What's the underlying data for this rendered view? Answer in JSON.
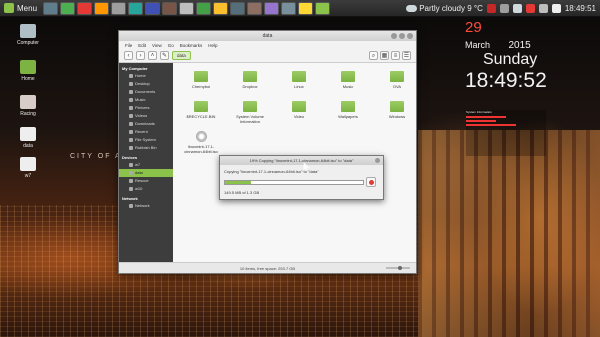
{
  "panel": {
    "menu_label": "Menu",
    "launcher_colors": [
      "#607d8b",
      "#4caf50",
      "#e53935",
      "#ff9800",
      "#9e9e9e",
      "#26a69a",
      "#3f51b5",
      "#795548",
      "#bdbdbd",
      "#43a047",
      "#fbc02d",
      "#546e7a",
      "#8d6e63",
      "#9575cd",
      "#78909c",
      "#fdd835",
      "#8bc34a"
    ],
    "weather_text": "Partly cloudy 9 °C",
    "clock_text": "18:49:51"
  },
  "desktop": {
    "icons": [
      {
        "label": "Computer",
        "color": "#b0bec5"
      },
      {
        "label": "Home",
        "color": "#7cb342"
      },
      {
        "label": "Racing",
        "color": "#d7ccc8"
      },
      {
        "label": "data",
        "color": "#eeeeee"
      },
      {
        "label": "w7",
        "color": "#eeeeee"
      }
    ],
    "wallpaper_text": "CITY OF A"
  },
  "clock_widget": {
    "day": "29",
    "month": "March",
    "year": "2015",
    "weekday": "Sunday",
    "time": "18:49:52",
    "sysinfo_title": "System Information"
  },
  "file_manager": {
    "title": "data",
    "menu": [
      "File",
      "Edit",
      "View",
      "Go",
      "Bookmarks",
      "Help"
    ],
    "location": "data",
    "sidebar": {
      "sections": [
        {
          "heading": "My Computer",
          "items": [
            "Home",
            "Desktop",
            "Documents",
            "Music",
            "Pictures",
            "Videos",
            "Downloads",
            "Recent",
            "File System",
            "Rubbish Bin"
          ]
        },
        {
          "heading": "Devices",
          "items": [
            "w7",
            "data",
            "Rescue",
            "w10"
          ]
        },
        {
          "heading": "Network",
          "items": [
            "Network"
          ]
        }
      ],
      "active_item": "data"
    },
    "files": [
      {
        "name": "Chernyboi",
        "kind": "folder"
      },
      {
        "name": "Dropbox",
        "kind": "folder"
      },
      {
        "name": "Linux",
        "kind": "folder"
      },
      {
        "name": "Music",
        "kind": "folder"
      },
      {
        "name": "OVA",
        "kind": "folder"
      },
      {
        "name": "$RECYCLE.BIN",
        "kind": "folder"
      },
      {
        "name": "System Volume Information",
        "kind": "folder"
      },
      {
        "name": "Video",
        "kind": "folder"
      },
      {
        "name": "Wallpapers",
        "kind": "folder"
      },
      {
        "name": "Windows",
        "kind": "folder"
      },
      {
        "name": "linuxmint-17.1-cinnamon-64bit.iso",
        "kind": "disc"
      }
    ],
    "status": "10 items, free space: 253.7 GB"
  },
  "copy_dialog": {
    "title": "19% Copying \"linuxmint-17.1-cinnamon-64bit.iso\" to \"data\"",
    "message": "Copying \"linuxmint-17.1-cinnamon-64bit.iso\" to \"data\"",
    "progress_fraction": 0.19,
    "stats": "149.5 MB of 1.3 GB"
  }
}
